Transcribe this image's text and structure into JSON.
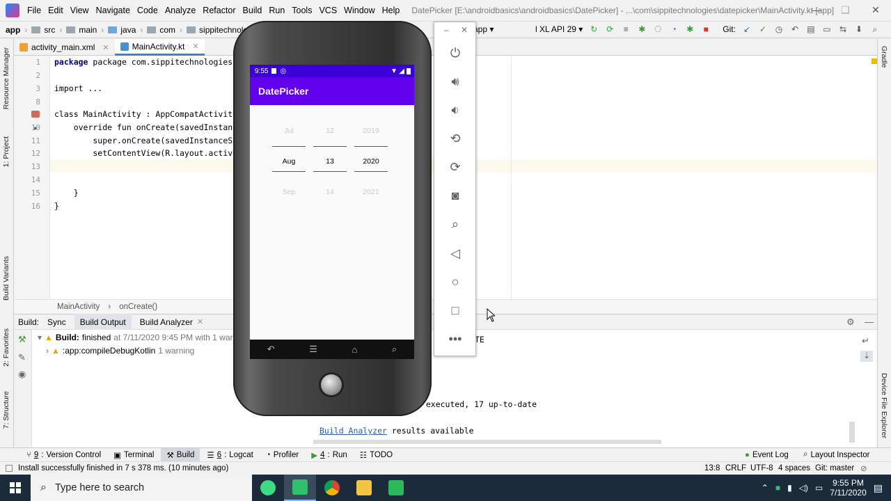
{
  "menubar": {
    "items": [
      "File",
      "Edit",
      "View",
      "Navigate",
      "Code",
      "Analyze",
      "Refactor",
      "Build",
      "Run",
      "Tools",
      "VCS",
      "Window",
      "Help"
    ],
    "title": "DatePicker [E:\\androidbasics\\androidbasics\\DatePicker] - ...\\com\\sippitechnologies\\datepicker\\MainActivity.kt [app]"
  },
  "navbar": {
    "crumbs": [
      "app",
      "src",
      "main",
      "java",
      "com",
      "sippitechnologies"
    ],
    "run_config": "app",
    "device": "l XL API 29",
    "git_label": "Git:"
  },
  "left_strip": [
    "Resource Manager",
    "1: Project",
    "Build Variants",
    "2: Favorites",
    "7: Structure"
  ],
  "right_strip": [
    "Gradle",
    "Device File Explorer"
  ],
  "tabs": [
    {
      "label": "activity_main.xml",
      "active": false
    },
    {
      "label": "MainActivity.kt",
      "active": true
    }
  ],
  "editor": {
    "line_numbers": [
      "1",
      "2",
      "3",
      "8",
      "9",
      "10",
      "11",
      "12",
      "13",
      "14",
      "15",
      "16"
    ],
    "lines": [
      "package com.sippitechnologies.datepicke",
      "",
      "import ...",
      "",
      "class MainActivity : AppCompatActivity(",
      "    override fun onCreate(savedInstance",
      "        super.onCreate(savedInstanceSta",
      "        setContentView(R.layout.activit",
      "",
      "",
      "    }",
      "}"
    ]
  },
  "code_breadcrumb": [
    "MainActivity",
    "onCreate()"
  ],
  "build": {
    "label": "Build:",
    "tabs": [
      "Sync",
      "Build Output",
      "Build Analyzer"
    ],
    "tree": [
      {
        "bold": "Build:",
        "text": "finished",
        "meta": "at 7/11/2020 9:45 PM with 1 warning"
      },
      {
        "bold": "",
        "text": ":app:compileDebugKotlin",
        "meta": "1 warning"
      }
    ],
    "output": {
      "partial_top": "TE",
      "executed": "4 executed, 17 up-to-date",
      "analyzer_link": "Build Analyzer",
      "analyzer_rest": " results available"
    }
  },
  "bottom_tools": [
    {
      "num": "9",
      "label": "Version Control"
    },
    {
      "num": "",
      "label": "Terminal"
    },
    {
      "num": "",
      "label": "Build",
      "active": true
    },
    {
      "num": "6",
      "label": "Logcat"
    },
    {
      "num": "",
      "label": "Profiler"
    },
    {
      "num": "4",
      "label": "Run"
    },
    {
      "num": "",
      "label": "TODO"
    }
  ],
  "bottom_right_tools": [
    "Event Log",
    "Layout Inspector"
  ],
  "status": {
    "message": "Install successfully finished in 7 s 378 ms. (10 minutes ago)",
    "position": "13:8",
    "line_sep": "CRLF",
    "encoding": "UTF-8",
    "indent": "4 spaces",
    "vcs": "Git: master"
  },
  "emulator": {
    "time": "9:55",
    "app_title": "DatePicker",
    "picker": {
      "month": [
        "Jul",
        "Aug",
        "Sep"
      ],
      "day": [
        "12",
        "13",
        "14"
      ],
      "year": [
        "2019",
        "2020",
        "2021"
      ]
    },
    "panel_icons": [
      "power-icon",
      "volume-up-icon",
      "volume-down-icon",
      "rotate-left-icon",
      "rotate-right-icon",
      "camera-icon",
      "zoom-icon",
      "back-icon",
      "home-icon",
      "overview-icon",
      "more-icon"
    ]
  },
  "taskbar": {
    "search_placeholder": "Type here to search",
    "time": "9:55 PM",
    "date": "7/11/2020"
  },
  "colors": {
    "accent": "#6200ee",
    "statusbar": "#3b00d6",
    "taskbar": "#1b2b3a"
  }
}
